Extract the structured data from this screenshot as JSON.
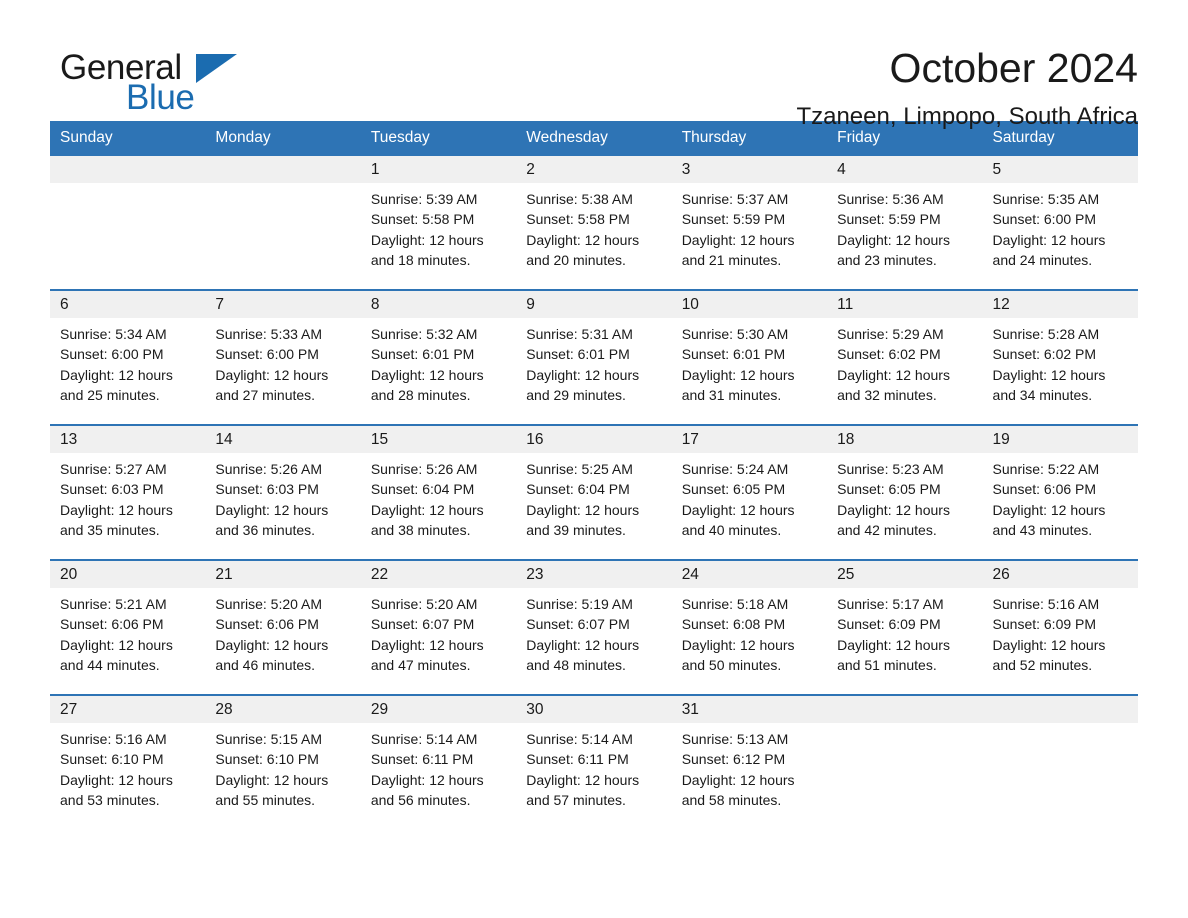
{
  "brand": {
    "name_part1": "General",
    "name_part2": "Blue",
    "accent_color": "#1b6cb0"
  },
  "header": {
    "title": "October 2024",
    "subtitle": "Tzaneen, Limpopo, South Africa"
  },
  "theme": {
    "header_blue": "#2e74b5",
    "daynum_band": "#f0f0f0",
    "text": "#1a1a1a"
  },
  "weekday_headers": [
    "Sunday",
    "Monday",
    "Tuesday",
    "Wednesday",
    "Thursday",
    "Friday",
    "Saturday"
  ],
  "weeks": [
    [
      {
        "day": "",
        "lines": []
      },
      {
        "day": "",
        "lines": []
      },
      {
        "day": "1",
        "lines": [
          "Sunrise: 5:39 AM",
          "Sunset: 5:58 PM",
          "Daylight: 12 hours",
          "and 18 minutes."
        ]
      },
      {
        "day": "2",
        "lines": [
          "Sunrise: 5:38 AM",
          "Sunset: 5:58 PM",
          "Daylight: 12 hours",
          "and 20 minutes."
        ]
      },
      {
        "day": "3",
        "lines": [
          "Sunrise: 5:37 AM",
          "Sunset: 5:59 PM",
          "Daylight: 12 hours",
          "and 21 minutes."
        ]
      },
      {
        "day": "4",
        "lines": [
          "Sunrise: 5:36 AM",
          "Sunset: 5:59 PM",
          "Daylight: 12 hours",
          "and 23 minutes."
        ]
      },
      {
        "day": "5",
        "lines": [
          "Sunrise: 5:35 AM",
          "Sunset: 6:00 PM",
          "Daylight: 12 hours",
          "and 24 minutes."
        ]
      }
    ],
    [
      {
        "day": "6",
        "lines": [
          "Sunrise: 5:34 AM",
          "Sunset: 6:00 PM",
          "Daylight: 12 hours",
          "and 25 minutes."
        ]
      },
      {
        "day": "7",
        "lines": [
          "Sunrise: 5:33 AM",
          "Sunset: 6:00 PM",
          "Daylight: 12 hours",
          "and 27 minutes."
        ]
      },
      {
        "day": "8",
        "lines": [
          "Sunrise: 5:32 AM",
          "Sunset: 6:01 PM",
          "Daylight: 12 hours",
          "and 28 minutes."
        ]
      },
      {
        "day": "9",
        "lines": [
          "Sunrise: 5:31 AM",
          "Sunset: 6:01 PM",
          "Daylight: 12 hours",
          "and 29 minutes."
        ]
      },
      {
        "day": "10",
        "lines": [
          "Sunrise: 5:30 AM",
          "Sunset: 6:01 PM",
          "Daylight: 12 hours",
          "and 31 minutes."
        ]
      },
      {
        "day": "11",
        "lines": [
          "Sunrise: 5:29 AM",
          "Sunset: 6:02 PM",
          "Daylight: 12 hours",
          "and 32 minutes."
        ]
      },
      {
        "day": "12",
        "lines": [
          "Sunrise: 5:28 AM",
          "Sunset: 6:02 PM",
          "Daylight: 12 hours",
          "and 34 minutes."
        ]
      }
    ],
    [
      {
        "day": "13",
        "lines": [
          "Sunrise: 5:27 AM",
          "Sunset: 6:03 PM",
          "Daylight: 12 hours",
          "and 35 minutes."
        ]
      },
      {
        "day": "14",
        "lines": [
          "Sunrise: 5:26 AM",
          "Sunset: 6:03 PM",
          "Daylight: 12 hours",
          "and 36 minutes."
        ]
      },
      {
        "day": "15",
        "lines": [
          "Sunrise: 5:26 AM",
          "Sunset: 6:04 PM",
          "Daylight: 12 hours",
          "and 38 minutes."
        ]
      },
      {
        "day": "16",
        "lines": [
          "Sunrise: 5:25 AM",
          "Sunset: 6:04 PM",
          "Daylight: 12 hours",
          "and 39 minutes."
        ]
      },
      {
        "day": "17",
        "lines": [
          "Sunrise: 5:24 AM",
          "Sunset: 6:05 PM",
          "Daylight: 12 hours",
          "and 40 minutes."
        ]
      },
      {
        "day": "18",
        "lines": [
          "Sunrise: 5:23 AM",
          "Sunset: 6:05 PM",
          "Daylight: 12 hours",
          "and 42 minutes."
        ]
      },
      {
        "day": "19",
        "lines": [
          "Sunrise: 5:22 AM",
          "Sunset: 6:06 PM",
          "Daylight: 12 hours",
          "and 43 minutes."
        ]
      }
    ],
    [
      {
        "day": "20",
        "lines": [
          "Sunrise: 5:21 AM",
          "Sunset: 6:06 PM",
          "Daylight: 12 hours",
          "and 44 minutes."
        ]
      },
      {
        "day": "21",
        "lines": [
          "Sunrise: 5:20 AM",
          "Sunset: 6:06 PM",
          "Daylight: 12 hours",
          "and 46 minutes."
        ]
      },
      {
        "day": "22",
        "lines": [
          "Sunrise: 5:20 AM",
          "Sunset: 6:07 PM",
          "Daylight: 12 hours",
          "and 47 minutes."
        ]
      },
      {
        "day": "23",
        "lines": [
          "Sunrise: 5:19 AM",
          "Sunset: 6:07 PM",
          "Daylight: 12 hours",
          "and 48 minutes."
        ]
      },
      {
        "day": "24",
        "lines": [
          "Sunrise: 5:18 AM",
          "Sunset: 6:08 PM",
          "Daylight: 12 hours",
          "and 50 minutes."
        ]
      },
      {
        "day": "25",
        "lines": [
          "Sunrise: 5:17 AM",
          "Sunset: 6:09 PM",
          "Daylight: 12 hours",
          "and 51 minutes."
        ]
      },
      {
        "day": "26",
        "lines": [
          "Sunrise: 5:16 AM",
          "Sunset: 6:09 PM",
          "Daylight: 12 hours",
          "and 52 minutes."
        ]
      }
    ],
    [
      {
        "day": "27",
        "lines": [
          "Sunrise: 5:16 AM",
          "Sunset: 6:10 PM",
          "Daylight: 12 hours",
          "and 53 minutes."
        ]
      },
      {
        "day": "28",
        "lines": [
          "Sunrise: 5:15 AM",
          "Sunset: 6:10 PM",
          "Daylight: 12 hours",
          "and 55 minutes."
        ]
      },
      {
        "day": "29",
        "lines": [
          "Sunrise: 5:14 AM",
          "Sunset: 6:11 PM",
          "Daylight: 12 hours",
          "and 56 minutes."
        ]
      },
      {
        "day": "30",
        "lines": [
          "Sunrise: 5:14 AM",
          "Sunset: 6:11 PM",
          "Daylight: 12 hours",
          "and 57 minutes."
        ]
      },
      {
        "day": "31",
        "lines": [
          "Sunrise: 5:13 AM",
          "Sunset: 6:12 PM",
          "Daylight: 12 hours",
          "and 58 minutes."
        ]
      },
      {
        "day": "",
        "lines": []
      },
      {
        "day": "",
        "lines": []
      }
    ]
  ]
}
